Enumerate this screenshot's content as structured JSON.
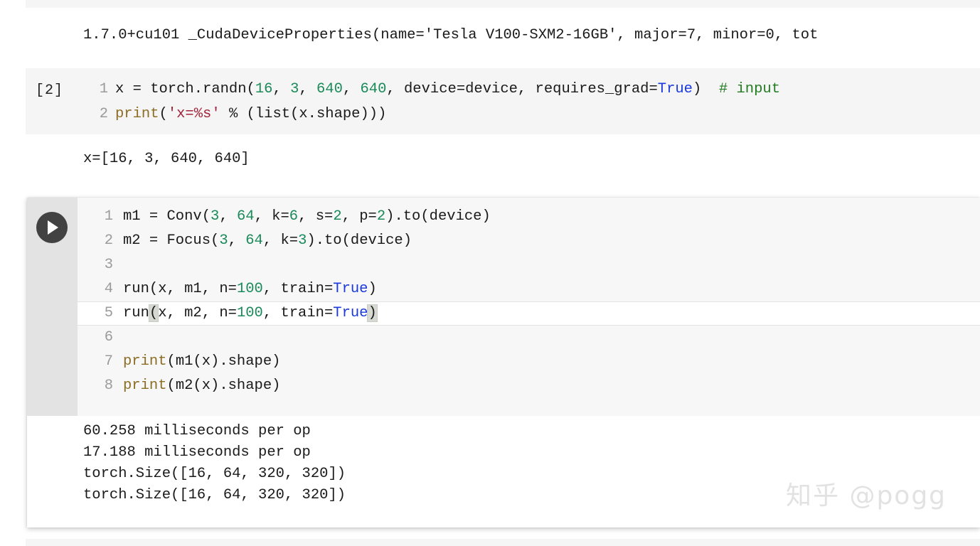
{
  "notebook": {
    "app": "jupyter-notebook",
    "top_clipped_cell": "",
    "outputs": {
      "version_line": "1.7.0+cu101 _CudaDeviceProperties(name='Tesla V100-SXM2-16GB', major=7, minor=0, tot",
      "shape_line": "x=[16, 3, 640, 640]"
    },
    "cell_2": {
      "prompt": "[2]",
      "lines": [
        {
          "n": "1",
          "tokens": [
            {
              "t": "x = torch.randn(",
              "c": "plain"
            },
            {
              "t": "16",
              "c": "tok-num"
            },
            {
              "t": ", ",
              "c": "plain"
            },
            {
              "t": "3",
              "c": "tok-num"
            },
            {
              "t": ", ",
              "c": "plain"
            },
            {
              "t": "640",
              "c": "tok-num"
            },
            {
              "t": ", ",
              "c": "plain"
            },
            {
              "t": "640",
              "c": "tok-num"
            },
            {
              "t": ", device=device, requires_grad=",
              "c": "plain"
            },
            {
              "t": "True",
              "c": "tok-bool"
            },
            {
              "t": ")  ",
              "c": "plain"
            },
            {
              "t": "# input",
              "c": "tok-cmt"
            }
          ]
        },
        {
          "n": "2",
          "tokens": [
            {
              "t": "print",
              "c": "tok-fn"
            },
            {
              "t": "(",
              "c": "plain"
            },
            {
              "t": "'x=%s'",
              "c": "tok-str"
            },
            {
              "t": " % (list(x.shape)))",
              "c": "plain"
            }
          ]
        }
      ]
    },
    "cell_main": {
      "run_button_label": "run-cell",
      "lines": [
        {
          "n": "1",
          "active": false,
          "tokens": [
            {
              "t": "m1 = Conv(",
              "c": "plain"
            },
            {
              "t": "3",
              "c": "tok-num"
            },
            {
              "t": ", ",
              "c": "plain"
            },
            {
              "t": "64",
              "c": "tok-num"
            },
            {
              "t": ", k=",
              "c": "plain"
            },
            {
              "t": "6",
              "c": "tok-num"
            },
            {
              "t": ", s=",
              "c": "plain"
            },
            {
              "t": "2",
              "c": "tok-num"
            },
            {
              "t": ", p=",
              "c": "plain"
            },
            {
              "t": "2",
              "c": "tok-num"
            },
            {
              "t": ").to(device)",
              "c": "plain"
            }
          ]
        },
        {
          "n": "2",
          "active": false,
          "tokens": [
            {
              "t": "m2 = Focus(",
              "c": "plain"
            },
            {
              "t": "3",
              "c": "tok-num"
            },
            {
              "t": ", ",
              "c": "plain"
            },
            {
              "t": "64",
              "c": "tok-num"
            },
            {
              "t": ", k=",
              "c": "plain"
            },
            {
              "t": "3",
              "c": "tok-num"
            },
            {
              "t": ").to(device)",
              "c": "plain"
            }
          ]
        },
        {
          "n": "3",
          "active": false,
          "tokens": []
        },
        {
          "n": "4",
          "active": false,
          "tokens": [
            {
              "t": "run(x, m1, n=",
              "c": "plain"
            },
            {
              "t": "100",
              "c": "tok-num"
            },
            {
              "t": ", train=",
              "c": "plain"
            },
            {
              "t": "True",
              "c": "tok-bool"
            },
            {
              "t": ")",
              "c": "plain"
            }
          ]
        },
        {
          "n": "5",
          "active": true,
          "tokens": [
            {
              "t": "run",
              "c": "plain"
            },
            {
              "t": "(",
              "c": "brk"
            },
            {
              "t": "x, m2, n=",
              "c": "plain"
            },
            {
              "t": "100",
              "c": "tok-num"
            },
            {
              "t": ", train=",
              "c": "plain"
            },
            {
              "t": "True",
              "c": "tok-bool"
            },
            {
              "t": ")",
              "c": "brk"
            }
          ]
        },
        {
          "n": "6",
          "active": false,
          "tokens": []
        },
        {
          "n": "7",
          "active": false,
          "tokens": [
            {
              "t": "print",
              "c": "tok-fn"
            },
            {
              "t": "(m1(x).shape)",
              "c": "plain"
            }
          ]
        },
        {
          "n": "8",
          "active": false,
          "tokens": [
            {
              "t": "print",
              "c": "tok-fn"
            },
            {
              "t": "(m2(x).shape)",
              "c": "plain"
            }
          ]
        }
      ],
      "output_lines": [
        "60.258 milliseconds per op",
        "17.188 milliseconds per op",
        "torch.Size([16, 64, 320, 320])",
        "torch.Size([16, 64, 320, 320])"
      ]
    },
    "watermark": "知乎 @pogg",
    "colors": {
      "number": "#1a8a5a",
      "boolean": "#1a3ae0",
      "string": "#a3243b",
      "function": "#8b6d23",
      "comment": "#227c22",
      "run_button": "#424242",
      "gutter": "#e3e3e3",
      "code_bg": "#f7f7f7"
    }
  }
}
